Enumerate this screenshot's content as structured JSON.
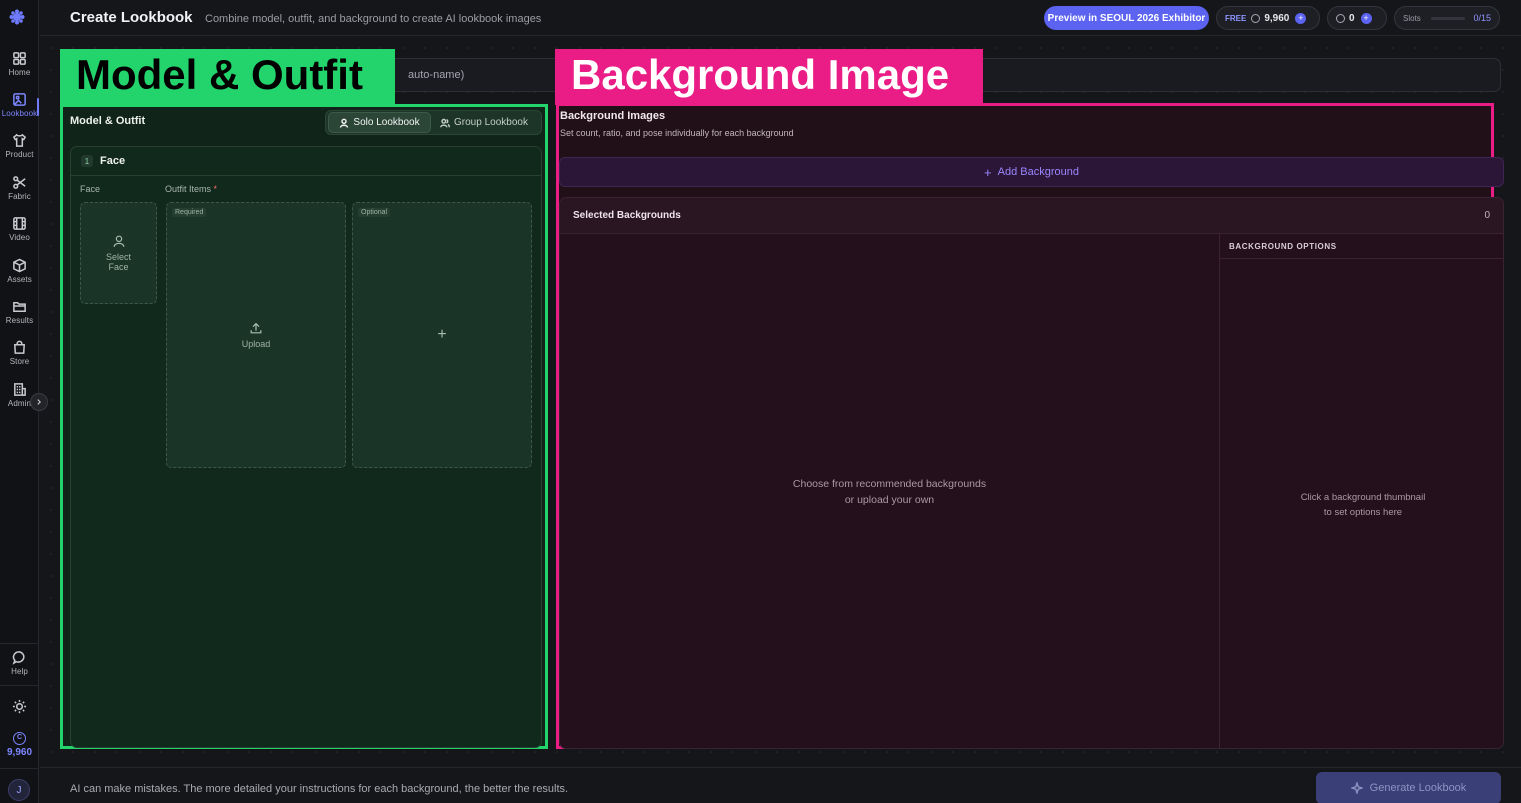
{
  "sidebar": {
    "items": [
      {
        "label": "Home",
        "icon": "grid-icon"
      },
      {
        "label": "Lookbook",
        "icon": "image-edit-icon"
      },
      {
        "label": "Product",
        "icon": "shirt-icon"
      },
      {
        "label": "Fabric",
        "icon": "scissors-icon"
      },
      {
        "label": "Video",
        "icon": "film-icon"
      },
      {
        "label": "Assets",
        "icon": "box-icon"
      },
      {
        "label": "Results",
        "icon": "folder-icon"
      },
      {
        "label": "Store",
        "icon": "bag-icon"
      },
      {
        "label": "Admin",
        "icon": "building-icon"
      }
    ],
    "active": "Lookbook",
    "help_label": "Help",
    "credits": "9,960",
    "avatar_initial": "J",
    "collapse_icon": "chevron-right-icon"
  },
  "header": {
    "title": "Create Lookbook",
    "subtitle": "Combine model, outfit, and background to create AI lookbook images",
    "preview_button": "Preview in SEOUL 2026 Exhibitor",
    "plan_badge": "FREE",
    "credits": "9,960",
    "secondary_credits": "0",
    "slots_label": "Slots",
    "slots_value": "0/15",
    "slots_fill": 0
  },
  "name_input": {
    "visible_text": "auto-name)"
  },
  "overlay_labels": {
    "model": "Model & Outfit",
    "background": "Background Image"
  },
  "model_panel": {
    "title": "Model & Outfit",
    "mode_options": [
      "Solo Lookbook",
      "Group Lookbook"
    ],
    "selected_mode": "Solo Lookbook",
    "face_card": {
      "number": "1",
      "title": "Face",
      "face_label": "Face",
      "outfit_label": "Outfit Items",
      "required_mark": "*",
      "select_face_line1": "Select",
      "select_face_line2": "Face",
      "required_tag": "Required",
      "upload_label": "Upload",
      "optional_tag": "Optional",
      "add_symbol": "+"
    }
  },
  "background_panel": {
    "title": "Background Images",
    "subtitle": "Set count, ratio, and pose individually for each background",
    "add_button": "Add Background",
    "selected_title": "Selected Backgrounds",
    "selected_count": "0",
    "empty_line1": "Choose from recommended backgrounds",
    "empty_line2": "or upload your own",
    "options_title": "BACKGROUND OPTIONS",
    "options_hint_line1": "Click a background thumbnail",
    "options_hint_line2": "to set options here"
  },
  "footer": {
    "note": "AI can make mistakes. The more detailed your instructions for each background, the better the results.",
    "generate_button": "Generate Lookbook"
  },
  "colors": {
    "accent": "#5b63f0",
    "model_highlight": "#22d46b",
    "background_highlight": "#ea1c85"
  }
}
